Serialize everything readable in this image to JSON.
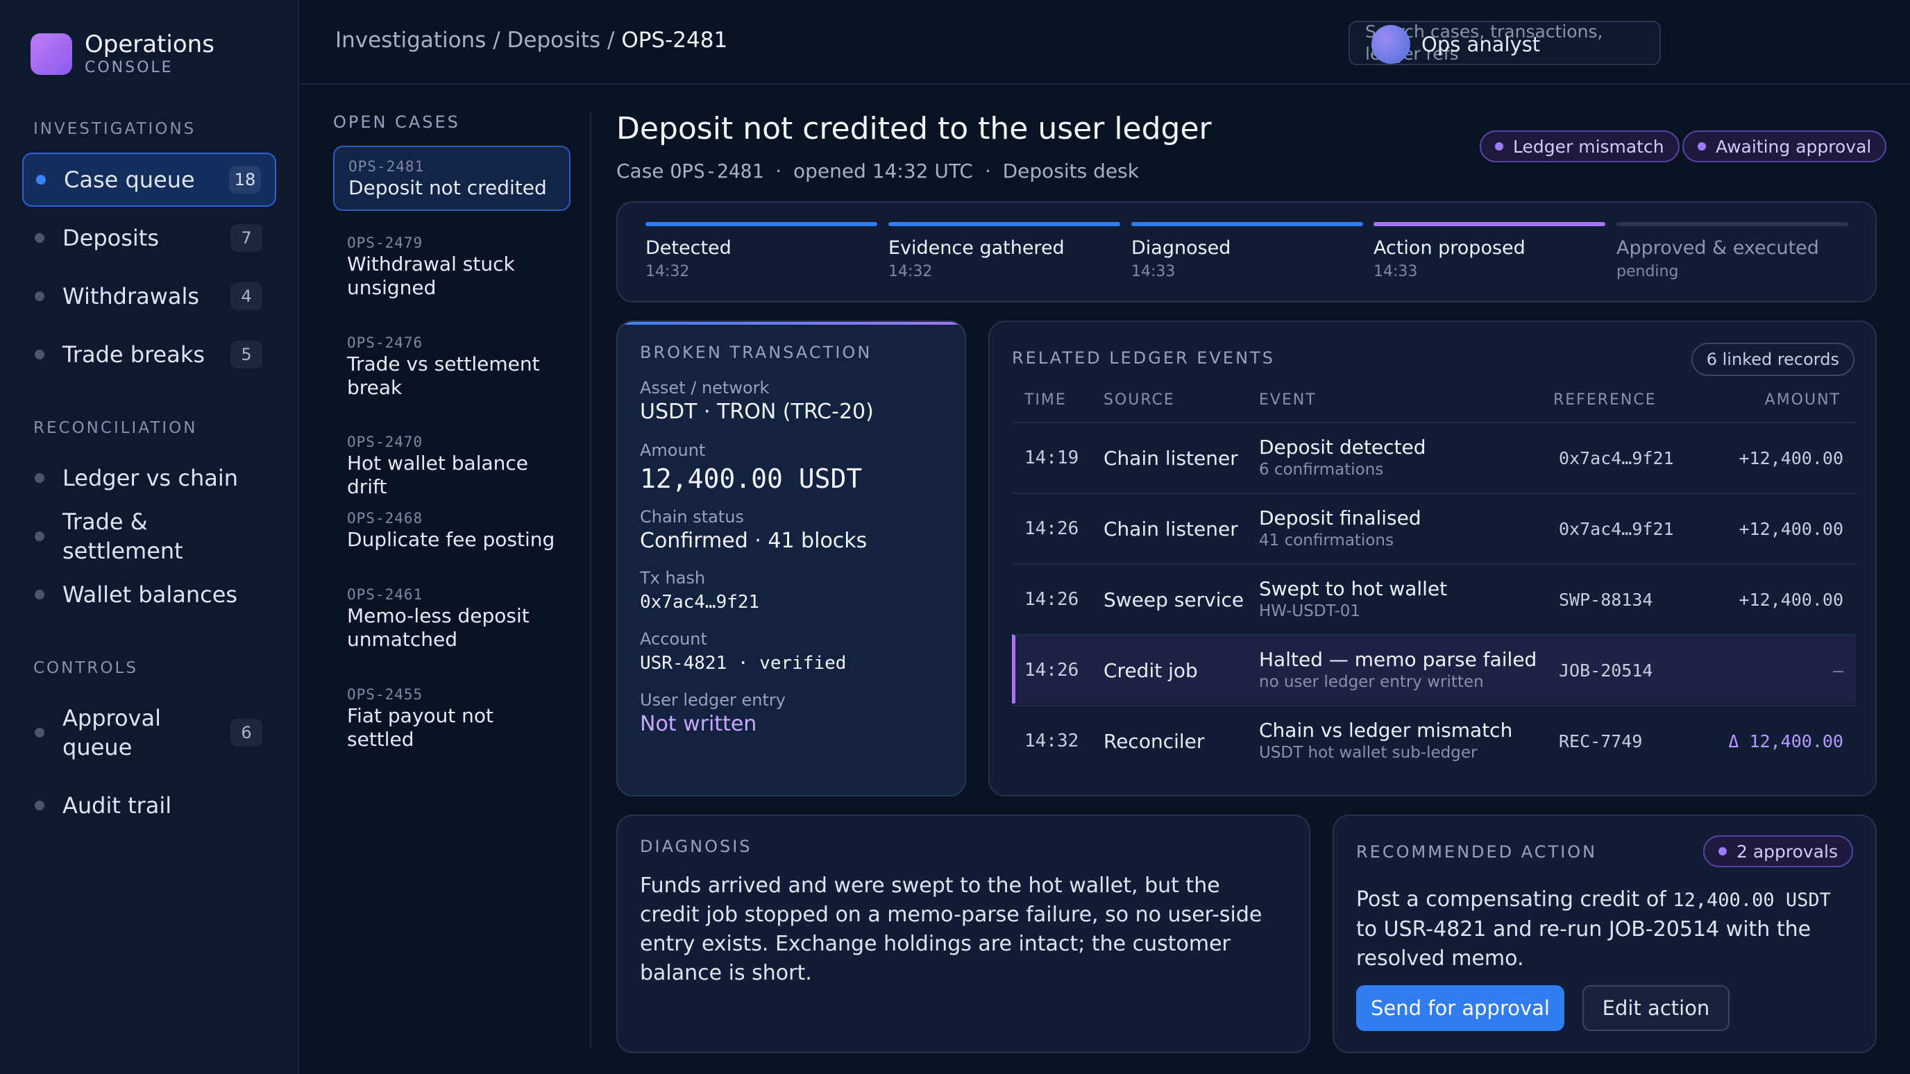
{
  "brand": {
    "title": "Operations",
    "subtitle": "CONSOLE"
  },
  "nav": {
    "investigations_label": "INVESTIGATIONS",
    "reconciliation_label": "RECONCILIATION",
    "controls_label": "CONTROLS",
    "investigations": [
      {
        "label": "Case queue",
        "count": "18",
        "active": true
      },
      {
        "label": "Deposits",
        "count": "7"
      },
      {
        "label": "Withdrawals",
        "count": "4"
      },
      {
        "label": "Trade breaks",
        "count": "5"
      }
    ],
    "reconciliation": [
      {
        "label": "Ledger vs chain"
      },
      {
        "label": "Trade & settlement"
      },
      {
        "label": "Wallet balances"
      }
    ],
    "controls": [
      {
        "label": "Approval queue",
        "count": "6"
      },
      {
        "label": "Audit trail"
      }
    ]
  },
  "topbar": {
    "crumb1": "Investigations",
    "crumb2": "Deposits",
    "crumb3": "OPS-2481",
    "separator": " / ",
    "search_placeholder": "Search cases, transactions, ledger refs",
    "user_name": "Ops analyst"
  },
  "cases": {
    "heading": "OPEN CASES",
    "items": [
      {
        "id": "OPS-2481",
        "title": "Deposit not credited",
        "active": true
      },
      {
        "id": "OPS-2479",
        "title": "Withdrawal stuck unsigned"
      },
      {
        "id": "OPS-2476",
        "title": "Trade vs settlement break"
      },
      {
        "id": "OPS-2470",
        "title": "Hot wallet balance drift"
      },
      {
        "id": "OPS-2468",
        "title": "Duplicate fee posting"
      },
      {
        "id": "OPS-2461",
        "title": "Memo-less deposit unmatched"
      },
      {
        "id": "OPS-2455",
        "title": "Fiat payout not settled"
      }
    ]
  },
  "header": {
    "title": "Deposit not credited to the user ledger",
    "case_label": "Case",
    "case_id": "OPS-2481",
    "opened": "opened 14:32 UTC",
    "desk": "Deposits desk",
    "dot_sep": "·",
    "tags": [
      "Ledger mismatch",
      "Awaiting approval"
    ]
  },
  "steps": [
    {
      "name": "Detected",
      "time": "14:32",
      "state": "done"
    },
    {
      "name": "Evidence gathered",
      "time": "14:32",
      "state": "done"
    },
    {
      "name": "Diagnosed",
      "time": "14:33",
      "state": "done"
    },
    {
      "name": "Action proposed",
      "time": "14:33",
      "state": "current"
    },
    {
      "name": "Approved & executed",
      "time": "pending",
      "state": "pending"
    }
  ],
  "broken_tx": {
    "heading": "BROKEN TRANSACTION",
    "asset_label": "Asset / network",
    "asset_value": "USDT · TRON (TRC-20)",
    "amount_label": "Amount",
    "amount_value": "12,400.00 USDT",
    "chain_label": "Chain status",
    "chain_value": "Confirmed · 41 blocks",
    "hash_label": "Tx hash",
    "hash_value": "0x7ac4…9f21",
    "account_label": "Account",
    "account_value": "USR-4821 · verified",
    "ledger_label": "User ledger entry",
    "ledger_value": "Not written",
    "ledger_value_color": "#c9a8ff"
  },
  "events": {
    "heading": "RELATED LEDGER EVENTS",
    "linked": "6 linked records",
    "columns": [
      "TIME",
      "SOURCE",
      "EVENT",
      "REFERENCE",
      "AMOUNT"
    ],
    "rows": [
      {
        "time": "14:19",
        "source": "Chain listener",
        "event": "Deposit detected",
        "detail": "6 confirmations",
        "ref": "0x7ac4…9f21",
        "amount": "+12,400.00"
      },
      {
        "time": "14:26",
        "source": "Chain listener",
        "event": "Deposit finalised",
        "detail": "41 confirmations",
        "ref": "0x7ac4…9f21",
        "amount": "+12,400.00"
      },
      {
        "time": "14:26",
        "source": "Sweep service",
        "event": "Swept to hot wallet",
        "detail": "HW-USDT-01",
        "ref": "SWP-88134",
        "amount": "+12,400.00"
      },
      {
        "time": "14:26",
        "source": "Credit job",
        "event": "Halted — memo parse failed",
        "detail": "no user ledger entry written",
        "ref": "JOB-20514",
        "amount": "—",
        "highlight": true
      },
      {
        "time": "14:32",
        "source": "Reconciler",
        "event": "Chain vs ledger mismatch",
        "detail": "USDT hot wallet sub-ledger",
        "ref": "REC-7749",
        "amount": "Δ 12,400.00",
        "delta": true
      }
    ]
  },
  "diagnosis": {
    "heading": "DIAGNOSIS",
    "text": "Funds arrived and were swept to the hot wallet, but the credit job stopped on a memo-parse failure, so no user-side entry exists. Exchange holdings are intact; the customer balance is short."
  },
  "recommended": {
    "heading": "RECOMMENDED ACTION",
    "badge": "2 approvals",
    "text_pre": "Post a compensating credit of",
    "text_amount": "12,400.00 USDT",
    "text_post": "to USR-4821 and re-run JOB-20514 with the resolved memo.",
    "primary_button": "Send for approval",
    "secondary_button": "Edit action"
  },
  "colors": {
    "accent": "#2f7df0",
    "purple": "#a477f2",
    "background": "#0a1324"
  }
}
